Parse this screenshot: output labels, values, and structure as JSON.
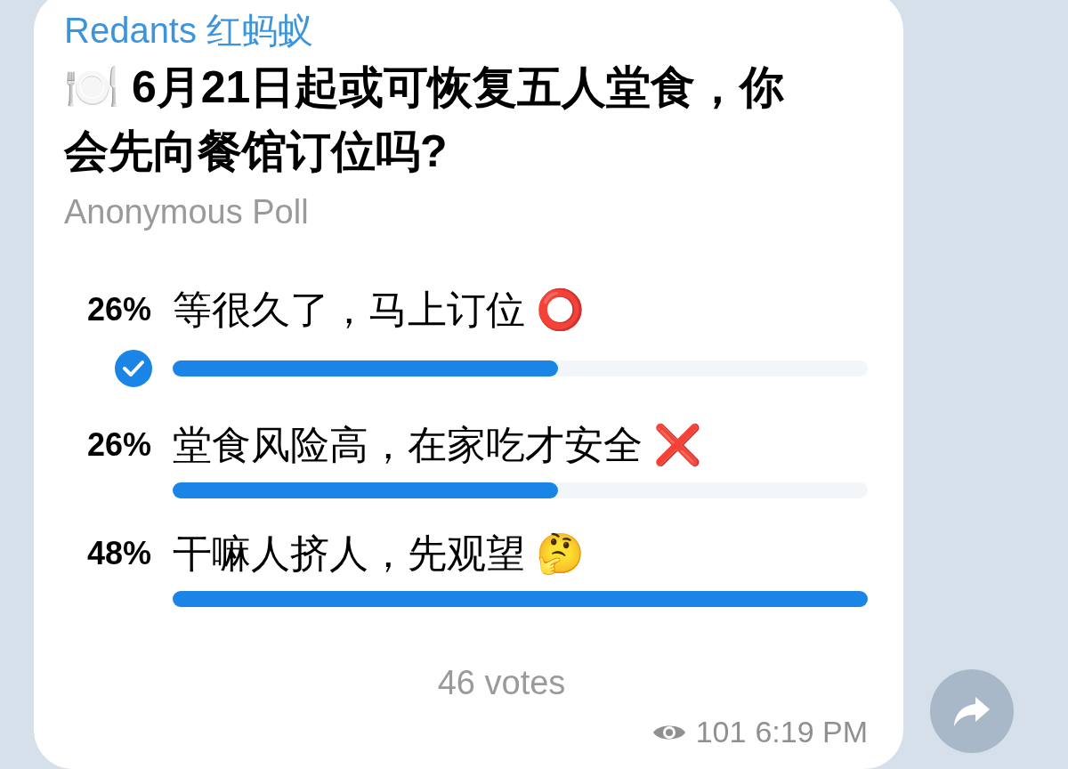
{
  "message": {
    "sender": "Redants 红蚂蚁",
    "question": "🍽️ 6月21日起或可恢复五人堂食，你会先向餐馆订位吗?",
    "poll_type": "Anonymous Poll",
    "options": [
      {
        "percent": "26%",
        "label": "等很久了，马上订位 ⭕",
        "level": 0.555,
        "selected": true
      },
      {
        "percent": "26%",
        "label": "堂食风险高，在家吃才安全 ❌",
        "level": 0.555,
        "selected": false
      },
      {
        "percent": "48%",
        "label": "干嘛人挤人，先观望 🤔",
        "level": 1,
        "selected": false
      }
    ],
    "votes": "46 votes",
    "views": "101",
    "time": "6:19 PM"
  }
}
